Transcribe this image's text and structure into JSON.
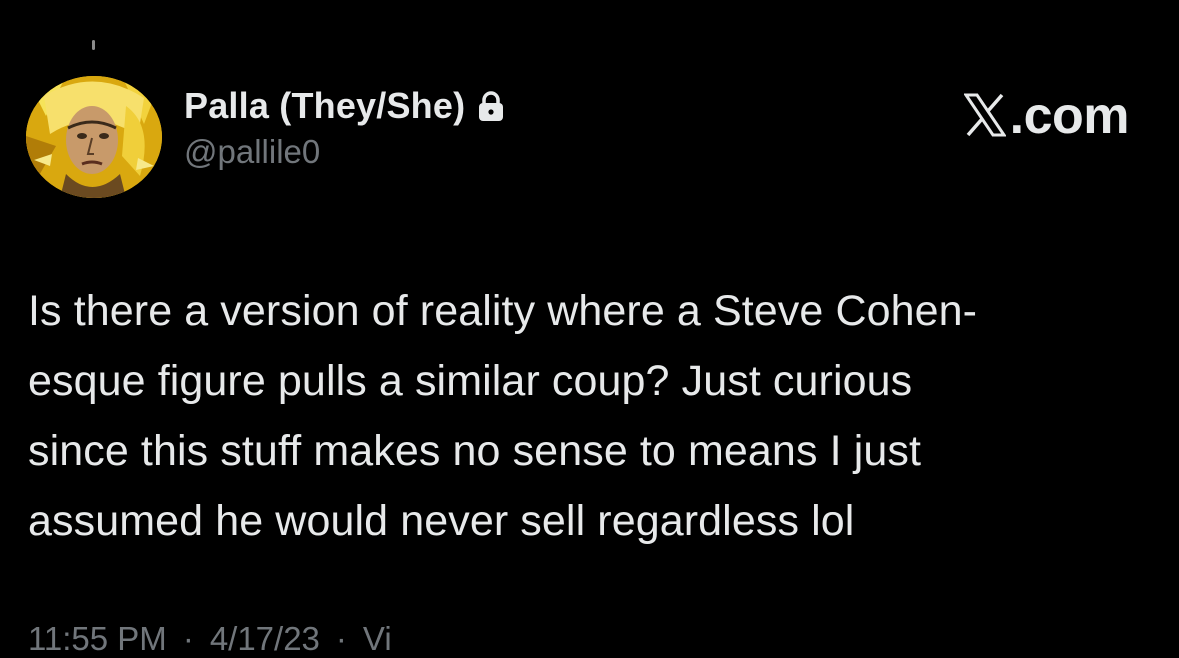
{
  "author": {
    "display_name": "Palla (They/She)",
    "handle": "@pallile0",
    "lock_icon": "lock-icon",
    "avatar": "illustrated-portrait-avatar"
  },
  "brand": {
    "logo_icon": "x-logo-icon",
    "label": ".com"
  },
  "tweet": {
    "text": "Is there a version of reality where a Steve Cohen-\nesque figure pulls a similar coup? Just curious\nsince this stuff makes no sense to means I just\nassumed he would never sell regardless lol"
  },
  "meta": {
    "time": "11:55 PM",
    "separator": "·",
    "date": "4/17/23",
    "views_label": "Vi"
  },
  "colors": {
    "background": "#000000",
    "text_primary": "#e7e9ea",
    "text_secondary": "#71767b"
  }
}
